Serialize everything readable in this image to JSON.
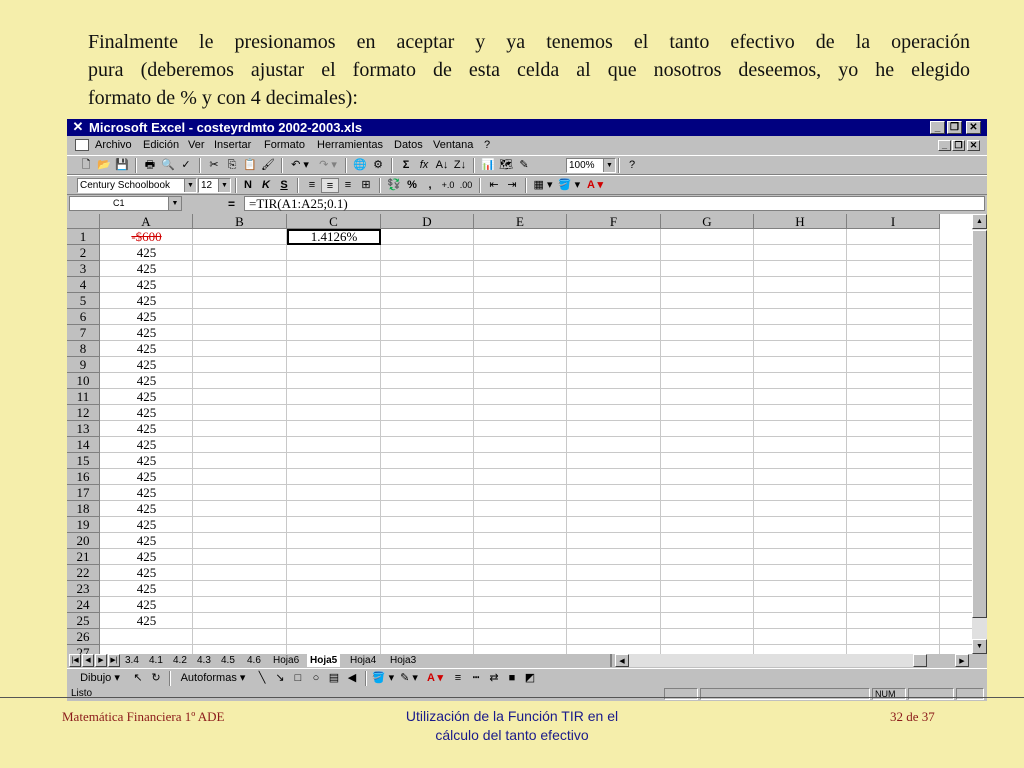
{
  "intro": {
    "line1": "Finalmente le presionamos en aceptar y ya tenemos el tanto efectivo de la operación",
    "line2": "pura (deberemos ajustar el formato de esta celda al que nosotros deseemos, yo he elegido",
    "line3": "formato de % y con 4 decimales):"
  },
  "window": {
    "title": "Microsoft Excel - costeyrdmto 2002-2003.xls",
    "app_icon": "excel-x-icon"
  },
  "menu": [
    "Archivo",
    "Edición",
    "Ver",
    "Insertar",
    "Formato",
    "Herramientas",
    "Datos",
    "Ventana",
    "?"
  ],
  "toolbar": {
    "zoom": "100%",
    "font_name": "Century Schoolbook",
    "font_size": "12",
    "bold_label": "N",
    "italic_label": "K",
    "underline_label": "S",
    "percent_label": "%",
    "comma_label": ",",
    "sum_label": "Σ",
    "fx_label": "fx"
  },
  "formula_bar": {
    "cell_ref": "C1",
    "equals": "=",
    "formula": "=TIR(A1:A25;0.1)"
  },
  "columns": [
    "A",
    "B",
    "C",
    "D",
    "E",
    "F",
    "G",
    "H",
    "I"
  ],
  "rows": [
    "1",
    "2",
    "3",
    "4",
    "5",
    "6",
    "7",
    "8",
    "9",
    "10",
    "11",
    "12",
    "13",
    "14",
    "15",
    "16",
    "17",
    "18",
    "19",
    "20",
    "21",
    "22",
    "23",
    "24",
    "25",
    "26",
    "27"
  ],
  "column_a": [
    "-$600",
    "425",
    "425",
    "425",
    "425",
    "425",
    "425",
    "425",
    "425",
    "425",
    "425",
    "425",
    "425",
    "425",
    "425",
    "425",
    "425",
    "425",
    "425",
    "425",
    "425",
    "425",
    "425",
    "425",
    "425"
  ],
  "cell_c1": "1.4126%",
  "sheet_tabs": [
    "3.4",
    "4.1",
    "4.2",
    "4.3",
    "4.5",
    "4.6",
    "Hoja6",
    "Hoja5",
    "Hoja4",
    "Hoja3"
  ],
  "active_sheet": "Hoja5",
  "drawing_bar": {
    "dibujo": "Dibujo",
    "autoformas": "Autoformas"
  },
  "status": {
    "text": "Listo",
    "num": "NUM"
  },
  "footer": {
    "left": "Matemática Financiera 1º ADE",
    "center_line1": "Utilización de la Función TIR en el",
    "center_line2": "cálculo del tanto efectivo",
    "right": "32 de 37"
  },
  "colors": {
    "slide_bg": "#f5eeab",
    "titlebar": "#000080",
    "negative_value": "#d00000",
    "footer_left": "#8b1a1a",
    "footer_center": "#1a1a8b"
  }
}
